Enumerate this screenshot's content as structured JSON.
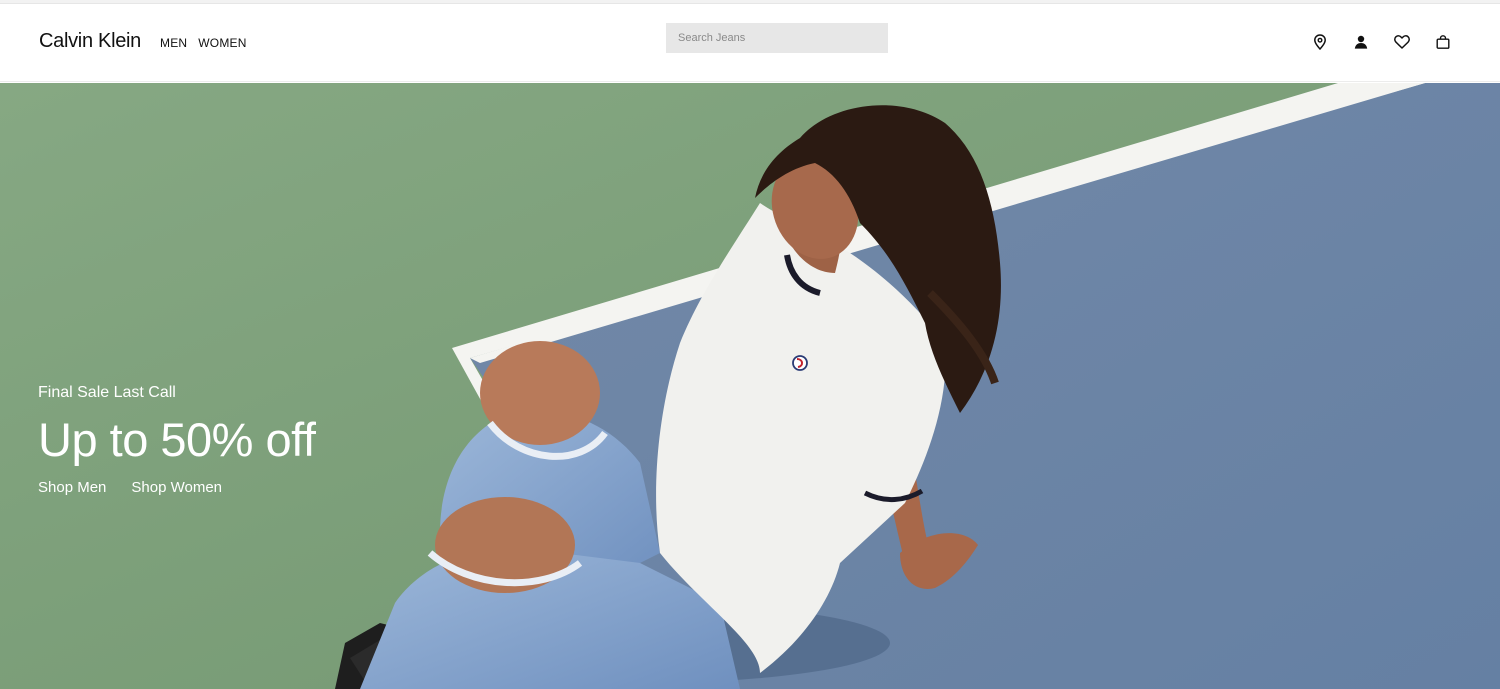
{
  "header": {
    "logo": "Calvin Klein",
    "nav": [
      {
        "label": "MEN"
      },
      {
        "label": "WOMEN"
      }
    ],
    "search": {
      "placeholder": "Search Jeans",
      "value": ""
    },
    "icons": [
      "location-pin-icon",
      "account-icon",
      "heart-icon",
      "shopping-bag-icon"
    ]
  },
  "hero": {
    "eyebrow": "Final Sale Last Call",
    "headline": "Up to 50% off",
    "links": [
      {
        "label": "Shop Men"
      },
      {
        "label": "Shop Women"
      }
    ],
    "colors": {
      "court_green": "#7fa27c",
      "court_blue": "#6f87a6",
      "court_line": "#f7f7f5",
      "text": "#ffffff"
    }
  }
}
